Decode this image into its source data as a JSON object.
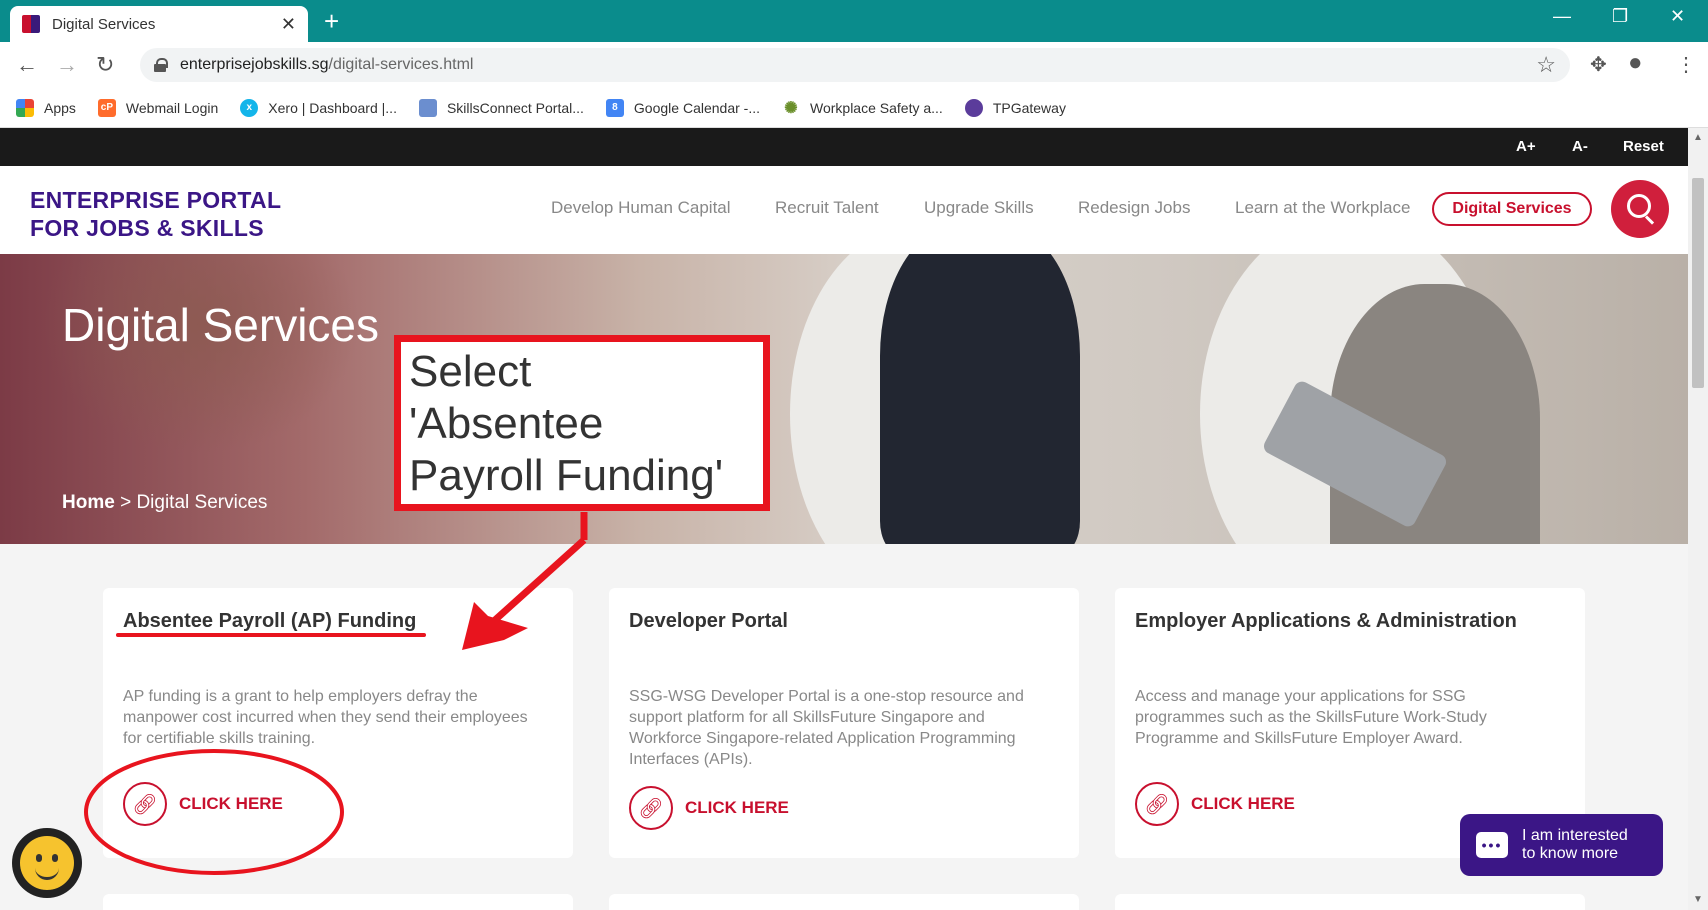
{
  "browser": {
    "tab_title": "Digital Services",
    "tab_close": "✕",
    "new_tab": "+",
    "url_domain": "enterprisejobskills.sg",
    "url_path": "/digital-services.html",
    "window_controls": [
      "—",
      "❐",
      "✕"
    ]
  },
  "bookmarks": [
    {
      "label": "Apps",
      "icon": "apps-grid-icon"
    },
    {
      "label": "Webmail Login",
      "icon": "cpanel-icon"
    },
    {
      "label": "Xero | Dashboard |...",
      "icon": "xero-icon"
    },
    {
      "label": "SkillsConnect Portal...",
      "icon": "skillsconnect-icon"
    },
    {
      "label": "Google Calendar -...",
      "icon": "calendar-icon"
    },
    {
      "label": "Workplace Safety a...",
      "icon": "wsh-icon"
    },
    {
      "label": "TPGateway",
      "icon": "tpgateway-icon"
    }
  ],
  "accessibility": {
    "increase": "A+",
    "decrease": "A-",
    "reset": "Reset"
  },
  "header": {
    "logo_line1": "ENTERPRISE PORTAL",
    "logo_line2": "FOR JOBS & SKILLS",
    "nav": [
      "Develop Human Capital",
      "Recruit Talent",
      "Upgrade Skills",
      "Redesign Jobs",
      "Learn at the Workplace"
    ],
    "active_button": "Digital Services"
  },
  "hero": {
    "title": "Digital Services",
    "breadcrumb_home": "Home",
    "breadcrumb_sep": " > ",
    "breadcrumb_current": "Digital Services"
  },
  "cards": [
    {
      "title": "Absentee Payroll (AP) Funding",
      "description": "AP funding is a grant to help employers defray the manpower cost incurred when they send their employees for certifiable skills training.",
      "link_label": "CLICK HERE"
    },
    {
      "title": "Developer Portal",
      "description": "SSG-WSG Developer Portal is a one-stop resource and support platform for all SkillsFuture Singapore and Workforce Singapore-related Application Programming Interfaces (APIs).",
      "link_label": "CLICK HERE"
    },
    {
      "title": "Employer Applications & Administration",
      "description": "Access and manage your applications for SSG programmes such as the SkillsFuture Work-Study Programme and SkillsFuture Employer Award.",
      "link_label": "CLICK HERE"
    }
  ],
  "chat": {
    "text_line1": "I am interested",
    "text_line2": "to know more"
  },
  "annotation": {
    "line1": "Select",
    "line2": "'Absentee",
    "line3": "Payroll Funding'"
  },
  "colors": {
    "brand_red": "#c8102e",
    "brand_purple": "#3b1686",
    "annotation_red": "#e8141e",
    "chrome_teal": "#0a8c8c"
  }
}
